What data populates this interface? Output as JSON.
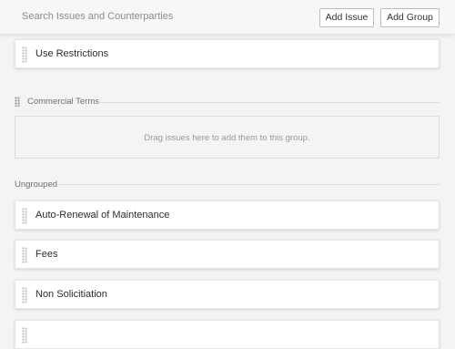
{
  "header": {
    "search_placeholder": "Search Issues and Counterparties",
    "add_issue_label": "Add Issue",
    "add_group_label": "Add Group"
  },
  "grouped_cards": [
    {
      "label": "Use Restrictions"
    }
  ],
  "groups": [
    {
      "title": "Commercial Terms",
      "empty_message": "Drag issues here to add them to this group."
    }
  ],
  "ungrouped": {
    "title": "Ungrouped",
    "items": [
      {
        "label": "Auto-Renewal of Maintenance"
      },
      {
        "label": "Fees"
      },
      {
        "label": "Non Solicitiation"
      },
      {
        "label": ""
      }
    ]
  },
  "colors": {
    "background": "#f4f4f4",
    "card": "#ffffff",
    "button_border": "#bdbdbd"
  }
}
